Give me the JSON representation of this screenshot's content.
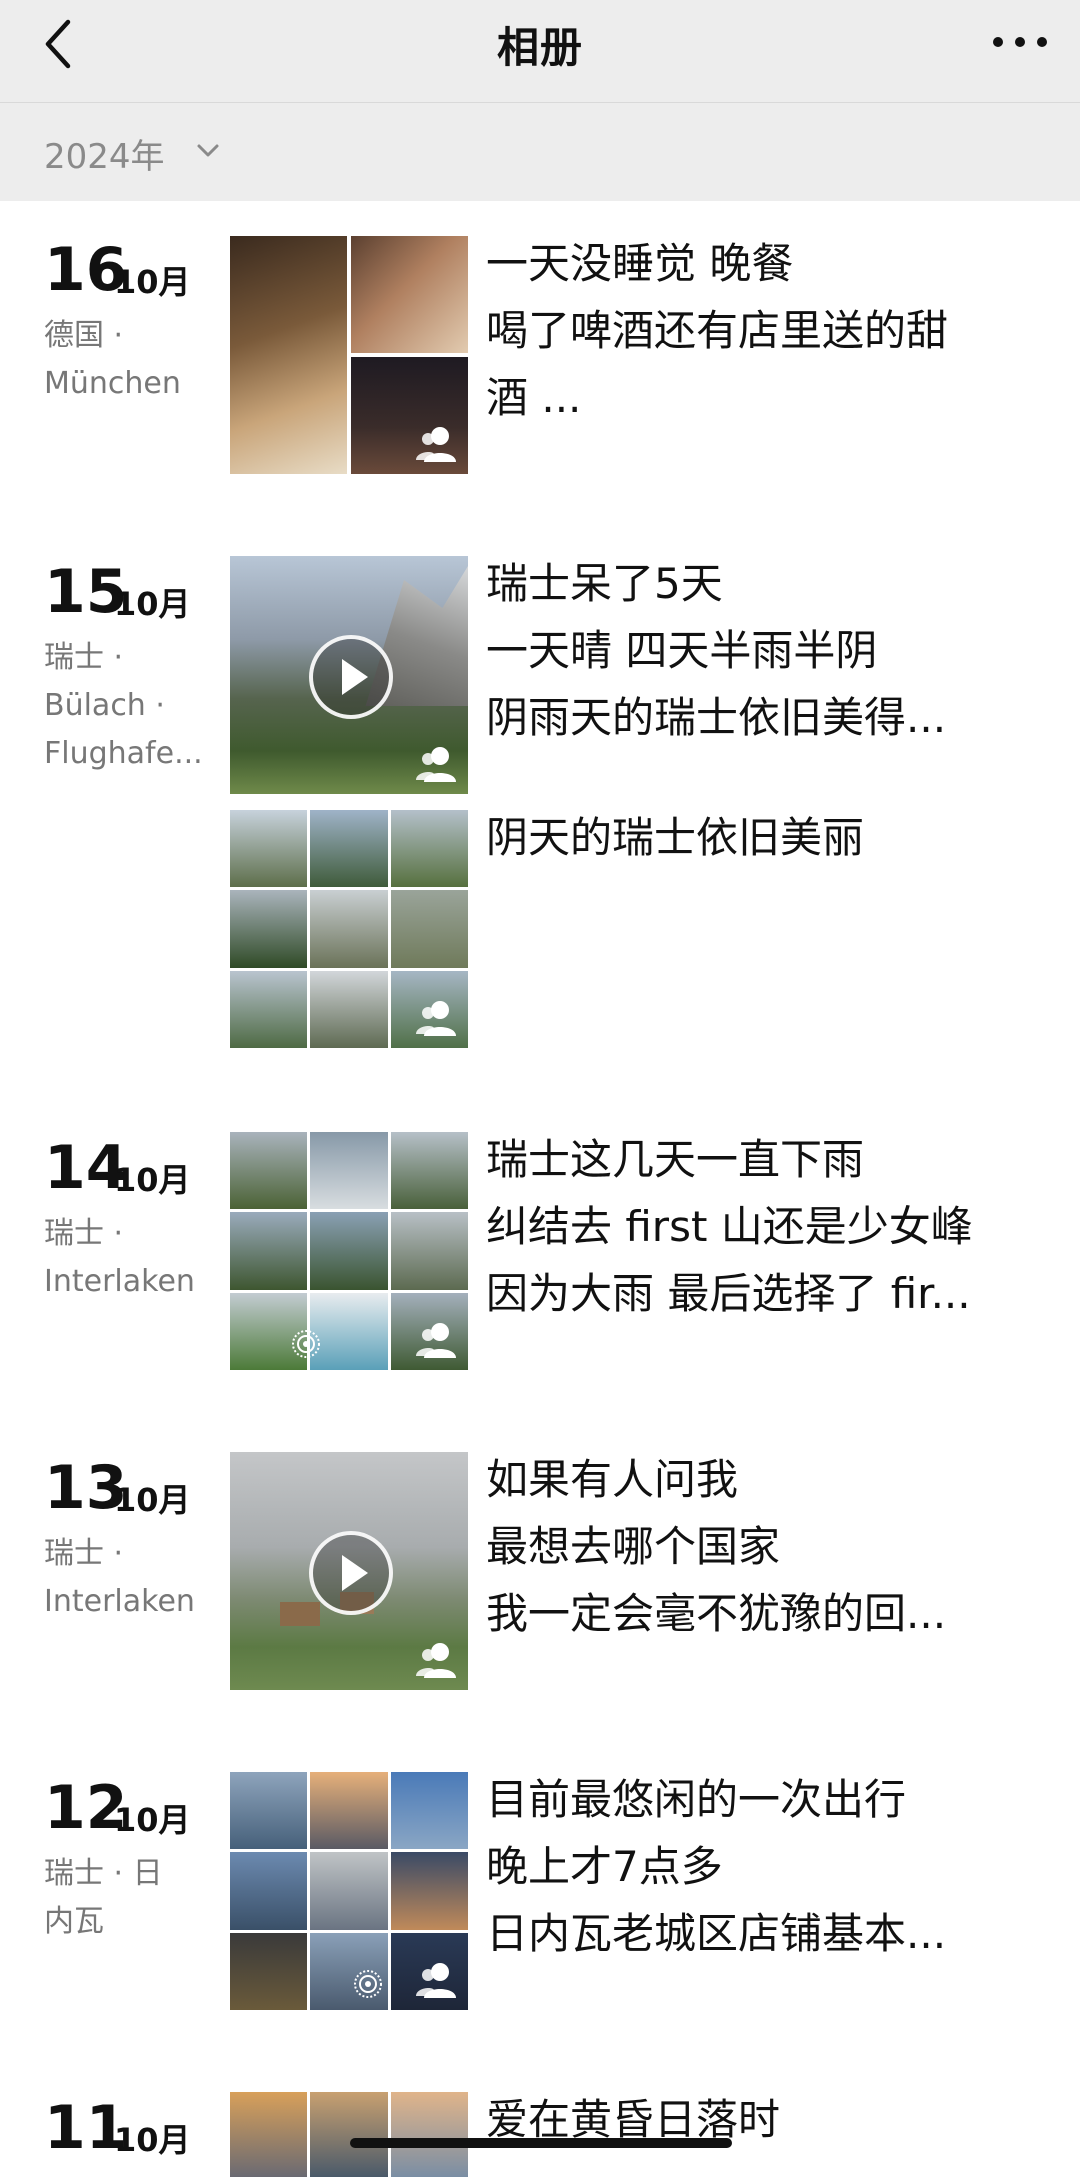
{
  "nav": {
    "title": "相册"
  },
  "year_bar": {
    "year": "2024年"
  },
  "entries": [
    {
      "day": "16",
      "month": "10月",
      "location": "德国 ·\nMünchen",
      "posts": [
        {
          "kind": "grid",
          "caption_lines": [
            "一天没睡觉 晚餐",
            "喝了啤酒还有店里送的甜",
            "酒 ..."
          ]
        }
      ]
    },
    {
      "day": "15",
      "month": "10月",
      "location": "瑞士 ·\nBülach ·\nFlughafe...",
      "posts": [
        {
          "kind": "video",
          "caption_lines": [
            "瑞士呆了5天",
            "一天晴 四天半雨半阴",
            "阴雨天的瑞士依旧美得..."
          ]
        },
        {
          "kind": "grid9",
          "caption_lines": [
            "阴天的瑞士依旧美丽"
          ]
        }
      ]
    },
    {
      "day": "14",
      "month": "10月",
      "location": "瑞士 ·\nInterlaken",
      "posts": [
        {
          "kind": "grid9",
          "caption_lines": [
            "瑞士这几天一直下雨",
            "纠结去 first 山还是少女峰",
            "因为大雨 最后选择了 fir..."
          ]
        }
      ]
    },
    {
      "day": "13",
      "month": "10月",
      "location": "瑞士 ·\nInterlaken",
      "posts": [
        {
          "kind": "video",
          "caption_lines": [
            "如果有人问我",
            "最想去哪个国家",
            "我一定会毫不犹豫的回..."
          ]
        }
      ]
    },
    {
      "day": "12",
      "month": "10月",
      "location": "瑞士 · 日\n内瓦",
      "posts": [
        {
          "kind": "grid9",
          "caption_lines": [
            "目前最悠闲的一次出行",
            "晚上才7点多",
            "日内瓦老城区店铺基本..."
          ]
        }
      ]
    },
    {
      "day": "11",
      "month": "10月",
      "location": "",
      "posts": [
        {
          "kind": "grid9",
          "caption_lines": [
            "爱在黄昏日落时"
          ]
        }
      ]
    }
  ]
}
